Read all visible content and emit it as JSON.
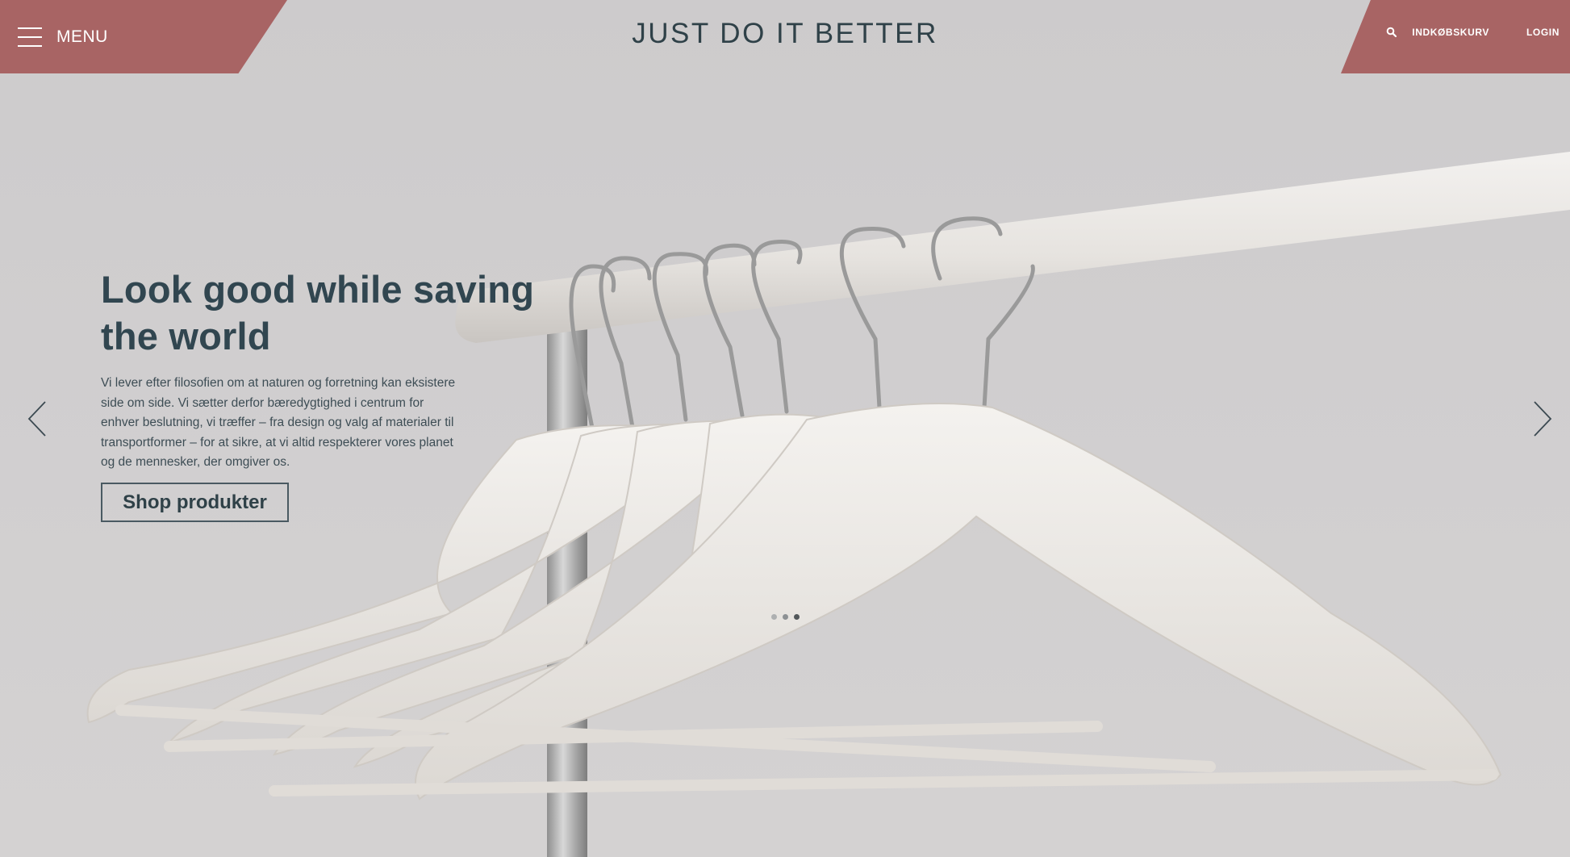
{
  "header": {
    "menu_label": "MENU",
    "brand": "JUST DO IT BETTER",
    "cart_label": "INDKØBSKURV",
    "login_label": "LOGIN"
  },
  "hero": {
    "title": "Look good while saving the world",
    "text": " Vi lever efter filosofien om at naturen og forretning kan eksistere side om side. Vi sætter derfor bæredygtighed i centrum for enhver beslutning, vi træffer – fra design og valg af materialer til transportformer – for at sikre, at vi altid respekterer vores planet og de mennesker, der omgiver os.",
    "button_label": "Shop produkter"
  },
  "slider": {
    "slide_count": 3,
    "active_index": 2
  },
  "colors": {
    "accent": "#a86464",
    "text_dark": "#314650",
    "background": "#d2d0d1"
  },
  "icons": {
    "menu": "hamburger-icon",
    "search": "search-icon",
    "prev": "chevron-left-icon",
    "next": "chevron-right-icon"
  }
}
